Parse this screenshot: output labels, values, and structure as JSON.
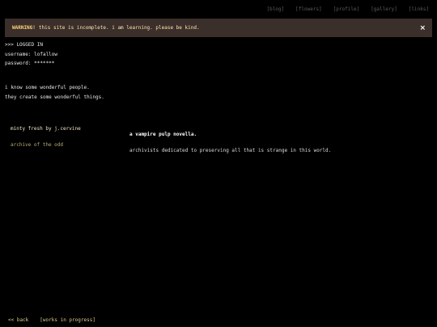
{
  "nav": {
    "items": [
      "[blog]",
      "[flowers]",
      "[profile]",
      "[gallery]",
      "[links]"
    ]
  },
  "banner": {
    "warning_label": "WARNING!",
    "message": "this site is incomplete. i am learning. please be kind.",
    "close_glyph": "×"
  },
  "session": {
    "status": ">>> LOGGED IN",
    "username": "username: lofallow",
    "password": "password: *******"
  },
  "intro": {
    "line1": "i know some wonderful people.",
    "line2": "they create some wonderful things."
  },
  "projects": [
    {
      "name": "minty fresh by j.cervine",
      "description": "a vampire pulp novella."
    },
    {
      "name": "archive of the odd",
      "description": "archivists dedicated to preserving all that is strange in this world."
    }
  ],
  "footer": {
    "back": "<< back",
    "wip": "[works in progress]"
  },
  "colors": {
    "background": "#000000",
    "banner_bg": "#3b2f2b",
    "warning": "#ffd27a",
    "link": "#d9cf8e",
    "nav": "#5c5c5c"
  }
}
